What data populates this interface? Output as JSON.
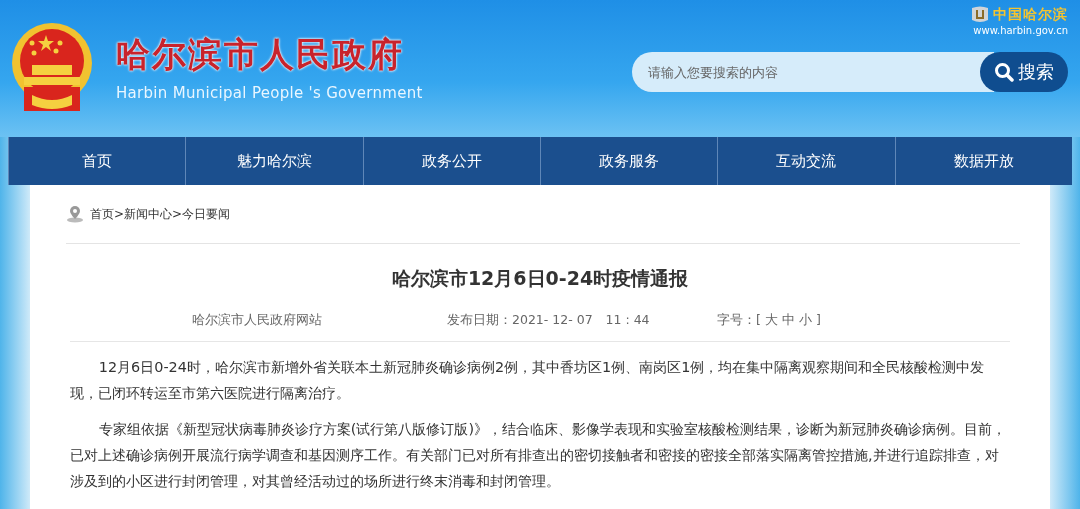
{
  "header": {
    "title": "哈尔滨市人民政府",
    "subtitle": "Harbin Municipal People 's Government",
    "logo_text": "中国哈尔滨",
    "logo_url": "www.harbin.gov.cn",
    "search": {
      "placeholder": "请输入您要搜索的内容",
      "button": "搜索"
    }
  },
  "nav": [
    "首页",
    "魅力哈尔滨",
    "政务公开",
    "政务服务",
    "互动交流",
    "数据开放"
  ],
  "breadcrumb": "首页>新闻中心>今日要闻",
  "article": {
    "title": "哈尔滨市12月6日0-24时疫情通报",
    "source": "哈尔滨市人民政府网站",
    "date_label": "发布日期：",
    "date": "2021- 12- 07　11 : 44",
    "size_label": "字号：[",
    "sizes": [
      "大",
      "中",
      "小"
    ],
    "size_close": "]",
    "paragraphs": [
      "12月6日0-24时，哈尔滨市新增外省关联本土新冠肺炎确诊病例2例，其中香坊区1例、南岗区1例，均在集中隔离观察期间和全民核酸检测中发现，已闭环转运至市第六医院进行隔离治疗。",
      "专家组依据《新型冠状病毒肺炎诊疗方案(试行第八版修订版)》，结合临床、影像学表现和实验室核酸检测结果，诊断为新冠肺炎确诊病例。目前，已对上述确诊病例开展流行病学调查和基因测序工作。有关部门已对所有排查出的密切接触者和密接的密接全部落实隔离管控措施,并进行追踪排查，对涉及到的小区进行封闭管理，对其曾经活动过的场所进行终末消毒和封闭管理。"
    ]
  }
}
